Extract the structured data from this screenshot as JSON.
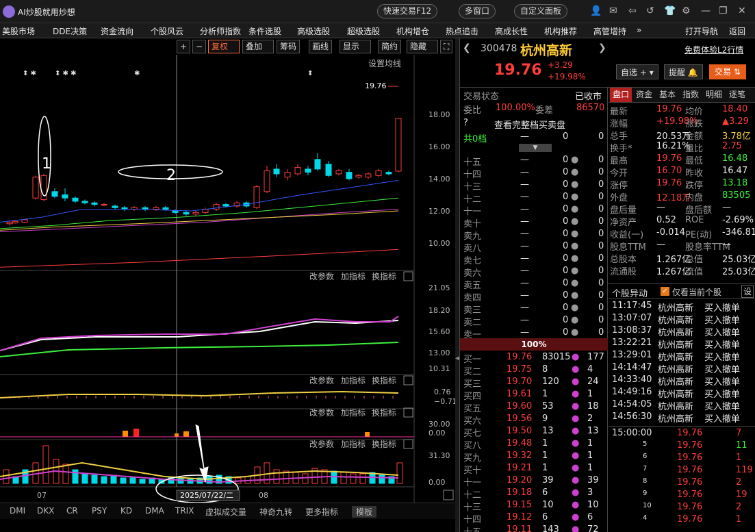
{
  "app": {
    "title": "AI炒股就用炒想",
    "quick_trade": "快速交易F12",
    "multi_window": "多窗口",
    "custom_panel": "自定义面板"
  },
  "menu": [
    "美股市场",
    "DDE决策",
    "资金流向",
    "个股风云",
    "分析师指数",
    "条件选股",
    "高级选股",
    "超级选股",
    "机构增仓",
    "热点追击",
    "高成长性",
    "机构推荐",
    "高管增持",
    "»",
    "打开导航",
    "返回"
  ],
  "toolbar": {
    "plus": "+",
    "minus": "−",
    "fuquan": "复权",
    "diejia": "叠加",
    "chouma": "筹码",
    "huaxian": "画线",
    "xianshi": "显示",
    "jianyue": "简约",
    "yincang": "隐藏"
  },
  "chart": {
    "set_ma": "设置均线",
    "price_label": "19.76",
    "y_ticks": [
      "18.00",
      "16.00",
      "14.00",
      "12.00",
      "10.00"
    ],
    "ind_ticks": [
      "21.05",
      "18.20",
      "15.60",
      "13.00",
      "10.31"
    ],
    "ind2_ticks": [
      "0.76",
      "−0.71"
    ],
    "ind3_ticks": [
      "30.00",
      "0.00"
    ],
    "ind4_ticks": [
      "31.30",
      "0.00"
    ],
    "panel_btns": [
      "改参数",
      "加指标",
      "换指标",
      "✕"
    ],
    "annot1": "1",
    "annot2": "2",
    "date_label": "2025/07/22/二",
    "month07": "07",
    "month08": "08",
    "markers": [
      "⬍ ✱",
      "⬍ ✱ ✱",
      "✱",
      "⬍"
    ]
  },
  "bottom_tabs": [
    "DMI",
    "DKX",
    "CR",
    "PSY",
    "KD",
    "DMA",
    "TRIX",
    "虚拟成交量",
    "神奇九转",
    "更多指标",
    "模板"
  ],
  "stock": {
    "code": "300478",
    "name": "杭州高新",
    "trial": "免费体验L2行情",
    "price": "19.76",
    "change": "+3.29",
    "pct": "+19.98%",
    "zixuan": "自选 +",
    "tixing": "提醒",
    "jiaoyi": "交易"
  },
  "trade_status": {
    "label": "交易状态",
    "value": "已收市"
  },
  "weibi": {
    "label": "委比",
    "value": "100.00%",
    "wc_label": "委差",
    "wc": "86570"
  },
  "full_book": "查看完整档买卖盘",
  "gong0": {
    "label": "共0档",
    "a": "—",
    "b": "0",
    "c": "0"
  },
  "sell_levels": [
    "十五",
    "十四",
    "十三",
    "十二",
    "十一",
    "卖十",
    "卖九",
    "卖八",
    "卖七",
    "卖六",
    "卖五",
    "卖四",
    "卖三",
    "卖二",
    "卖一"
  ],
  "pct_bar": "100%",
  "buys": [
    [
      "买一",
      "19.76",
      "83015",
      "177"
    ],
    [
      "买二",
      "19.75",
      "8",
      "4"
    ],
    [
      "买三",
      "19.70",
      "120",
      "24"
    ],
    [
      "买四",
      "19.61",
      "1",
      "1"
    ],
    [
      "买五",
      "19.60",
      "53",
      "18"
    ],
    [
      "买六",
      "19.56",
      "9",
      "2"
    ],
    [
      "买七",
      "19.50",
      "13",
      "13"
    ],
    [
      "买八",
      "19.48",
      "1",
      "1"
    ],
    [
      "买九",
      "19.32",
      "1",
      "1"
    ],
    [
      "买十",
      "19.21",
      "1",
      "1"
    ],
    [
      "十一",
      "19.20",
      "39",
      "39"
    ],
    [
      "十二",
      "19.18",
      "6",
      "3"
    ],
    [
      "十三",
      "19.15",
      "10",
      "10"
    ],
    [
      "十四",
      "19.12",
      "6",
      "6"
    ],
    [
      "十五",
      "19.11",
      "143",
      "72"
    ]
  ],
  "quote_tabs": [
    "盘口",
    "资金",
    "基本",
    "指数",
    "明细",
    "逐笔"
  ],
  "quote": [
    [
      "最新",
      "19.76",
      "均价",
      "18.40"
    ],
    [
      "涨幅",
      "+19.98%",
      "涨跌",
      "▲3.29"
    ],
    [
      "总手",
      "20.53万",
      "金额",
      "3.78亿"
    ],
    [
      "换手*",
      "16.21%",
      "量比",
      "2.75"
    ],
    [
      "最高",
      "19.76",
      "最低",
      "16.48"
    ],
    [
      "今开",
      "16.70",
      "昨收",
      "16.47"
    ],
    [
      "涨停",
      "19.76",
      "跌停",
      "13.18"
    ],
    [
      "外盘",
      "12.18万",
      "内盘",
      "83505"
    ],
    [
      "盘后量",
      "—",
      "盘后额",
      "—"
    ],
    [
      "净资产",
      "0.52",
      "ROE",
      "-2.69%"
    ],
    [
      "收益(一)",
      "-0.014",
      "PE(动)",
      "-346.81"
    ],
    [
      "股息TTM",
      "—",
      "股息率TTM",
      "—"
    ],
    [
      "总股本",
      "1.267亿",
      "总值",
      "25.03亿"
    ],
    [
      "流通股",
      "1.267亿",
      "流值",
      "25.03亿"
    ]
  ],
  "yidong": {
    "title": "个股异动",
    "only": "仅看当前个股",
    "set": "设"
  },
  "events": [
    [
      "11:17:45",
      "杭州高新",
      "买入撤单"
    ],
    [
      "13:07:07",
      "杭州高新",
      "买入撤单"
    ],
    [
      "13:08:37",
      "杭州高新",
      "买入撤单"
    ],
    [
      "13:22:21",
      "杭州高新",
      "买入撤单"
    ],
    [
      "13:29:01",
      "杭州高新",
      "买入撤单"
    ],
    [
      "14:14:47",
      "杭州高新",
      "买入撤单"
    ],
    [
      "14:33:40",
      "杭州高新",
      "买入撤单"
    ],
    [
      "14:49:16",
      "杭州高新",
      "买入撤单"
    ],
    [
      "14:54:05",
      "杭州高新",
      "买入撤单"
    ],
    [
      "14:56:30",
      "杭州高新",
      "买入撤单"
    ]
  ],
  "ticks": [
    [
      "15:00:00",
      "19.76",
      "7"
    ],
    [
      "5",
      "19.76",
      "11"
    ],
    [
      "6",
      "19.76",
      "1"
    ],
    [
      "7",
      "19.76",
      "119"
    ],
    [
      "8",
      "19.76",
      "2"
    ],
    [
      "9",
      "19.76",
      "19"
    ],
    [
      "10",
      "19.76",
      "2"
    ],
    [
      "4",
      "19.76",
      "1"
    ]
  ],
  "colors": {
    "up": "#ff3c3c",
    "down": "#3cf03c",
    "ma5": "#ffffff",
    "ma10": "#f0d040",
    "ma20": "#d040d0",
    "ma60": "#3cf03c",
    "bg": "#000000"
  }
}
